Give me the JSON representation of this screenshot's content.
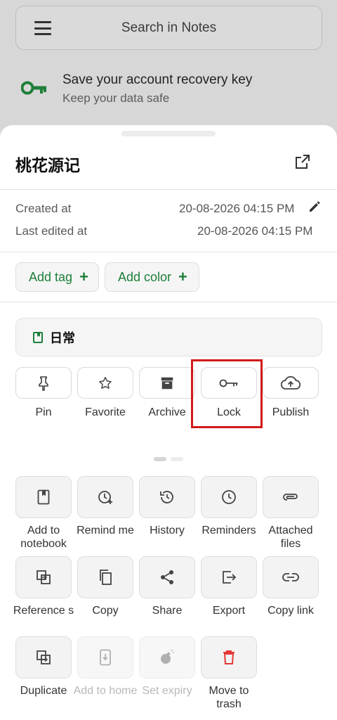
{
  "search": {
    "placeholder": "Search in Notes"
  },
  "recovery": {
    "title": "Save your account recovery key",
    "subtitle": "Keep your data safe",
    "accent": "#1e7f3a"
  },
  "note": {
    "title": "桃花源记",
    "created_label": "Created at",
    "created_value": "20-08-2026 04:15 PM",
    "edited_label": "Last edited at",
    "edited_value": "20-08-2026 04:15 PM"
  },
  "chips": {
    "add_tag": "Add tag",
    "add_color": "Add color",
    "plus": "+"
  },
  "notebook": {
    "label": "日常"
  },
  "quick_actions": [
    {
      "label": "Pin",
      "icon": "pin-icon"
    },
    {
      "label": "Favorite",
      "icon": "star-icon"
    },
    {
      "label": "Archive",
      "icon": "archive-icon"
    },
    {
      "label": "Lock",
      "icon": "key-icon"
    },
    {
      "label": "Publish",
      "icon": "cloud-upload-icon"
    }
  ],
  "grid": [
    {
      "label": "Add to notebook",
      "icon": "notebook-icon"
    },
    {
      "label": "Remind me",
      "icon": "alarm-add-icon"
    },
    {
      "label": "History",
      "icon": "history-icon"
    },
    {
      "label": "Reminders",
      "icon": "clock-icon"
    },
    {
      "label": "Attached files",
      "icon": "paperclip-icon"
    },
    {
      "label": "Reference s",
      "icon": "references-icon"
    },
    {
      "label": "Copy",
      "icon": "copy-icon"
    },
    {
      "label": "Share",
      "icon": "share-icon"
    },
    {
      "label": "Export",
      "icon": "export-icon"
    },
    {
      "label": "Copy link",
      "icon": "link-icon"
    },
    {
      "label": "Duplicate",
      "icon": "duplicate-icon"
    },
    {
      "label": "Add to home",
      "icon": "phone-download-icon",
      "disabled": true
    },
    {
      "label": "Set expiry",
      "icon": "bomb-icon",
      "disabled": true
    },
    {
      "label": "Move to trash",
      "icon": "trash-icon",
      "danger_color": "#e53935"
    }
  ],
  "colors": {
    "accent_green": "#1e7f3a",
    "danger_red": "#e53935",
    "highlight_red": "#d11a1a"
  }
}
